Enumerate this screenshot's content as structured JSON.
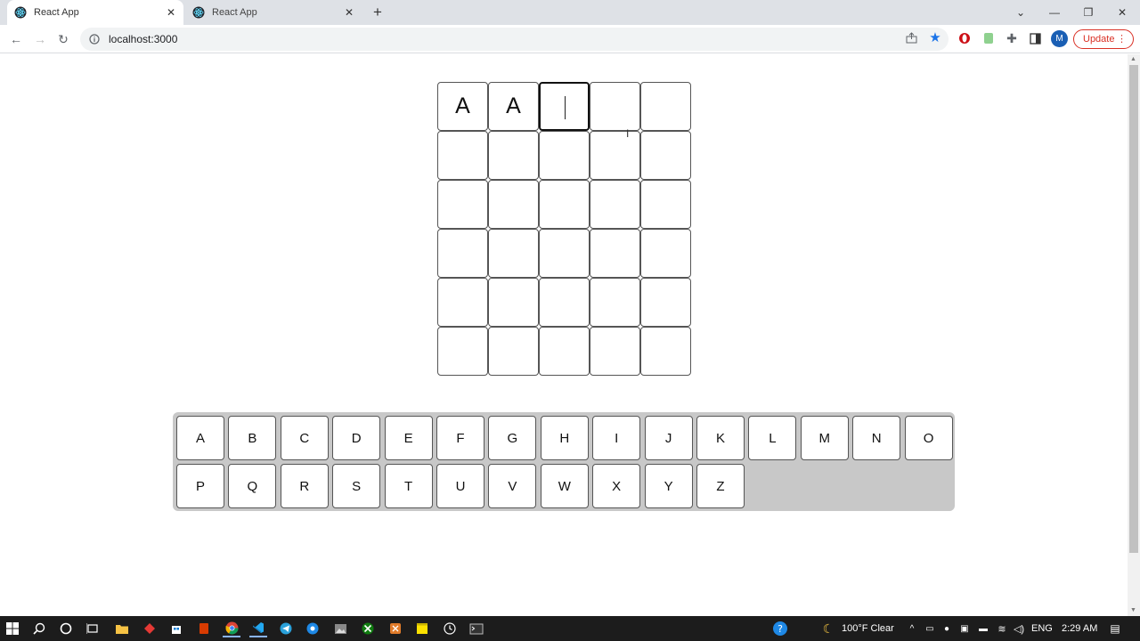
{
  "browser": {
    "tabs": [
      {
        "title": "React App",
        "active": true
      },
      {
        "title": "React App",
        "active": false
      }
    ],
    "url": "localhost:3000",
    "update_label": "Update",
    "profile_initial": "M"
  },
  "game": {
    "board": [
      [
        "A",
        "A",
        "",
        "",
        ""
      ],
      [
        "",
        "",
        "",
        "",
        ""
      ],
      [
        "",
        "",
        "",
        "",
        ""
      ],
      [
        "",
        "",
        "",
        "",
        ""
      ],
      [
        "",
        "",
        "",
        "",
        ""
      ],
      [
        "",
        "",
        "",
        "",
        ""
      ]
    ],
    "keyboard_row1": [
      "A",
      "B",
      "C",
      "D",
      "E",
      "F",
      "G",
      "H",
      "I",
      "J",
      "K",
      "L",
      "M",
      "N",
      "O"
    ],
    "keyboard_row2": [
      "P",
      "Q",
      "R",
      "S",
      "T",
      "U",
      "V",
      "W",
      "X",
      "Y",
      "Z"
    ]
  },
  "taskbar": {
    "weather": "100°F Clear",
    "language": "ENG",
    "time": "2:29 AM"
  },
  "colors": {
    "key_bg": "#ffffff",
    "keyboard_bg": "#c8c8c8",
    "update_red": "#d93025"
  }
}
